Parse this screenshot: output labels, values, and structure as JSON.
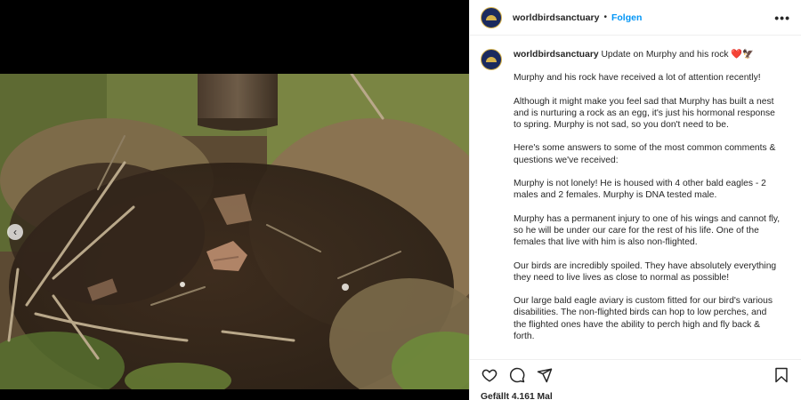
{
  "account": {
    "username": "worldbirdsanctuary",
    "follow_label": "Folgen",
    "separator": "•",
    "more_label": "•••"
  },
  "caption": {
    "username": "worldbirdsanctuary",
    "headline": "Update on Murphy and his rock",
    "emoji_heart": "❤️",
    "emoji_bird": "🦅",
    "paragraphs": [
      "Murphy and his rock have received a lot of attention recently!",
      "Although it might make you feel sad that Murphy has built a nest and is nurturing a rock as an egg, it's just his hormonal response to spring. Murphy is not sad, so you don't need to be.",
      "Here's some answers to some of the most common comments & questions we've received:",
      "Murphy is not lonely! He is housed with 4 other bald eagles - 2 males and 2 females. Murphy is DNA tested male.",
      "Murphy has a permanent injury to one of his wings and cannot fly, so he will be under our care for the rest of his life. One of the females that live with him is also non-flighted.",
      "Our birds are incredibly spoiled. They have absolutely everything they need to live lives as close to normal as possible!",
      "Our large bald eagle aviary is custom fitted for our bird's various disabilities. The non-flighted birds can hop to low perches, and the flighted ones have the ability to perch high and fly back & forth."
    ]
  },
  "media": {
    "prev_label": "‹",
    "alt": "Ground with dry grass, twigs and a tree trunk"
  },
  "icons": {
    "like": "heart-outline-icon",
    "comment": "comment-bubble-icon",
    "share": "paper-plane-icon",
    "save": "bookmark-icon"
  },
  "likes_text": "Gefällt 4.161 Mal"
}
